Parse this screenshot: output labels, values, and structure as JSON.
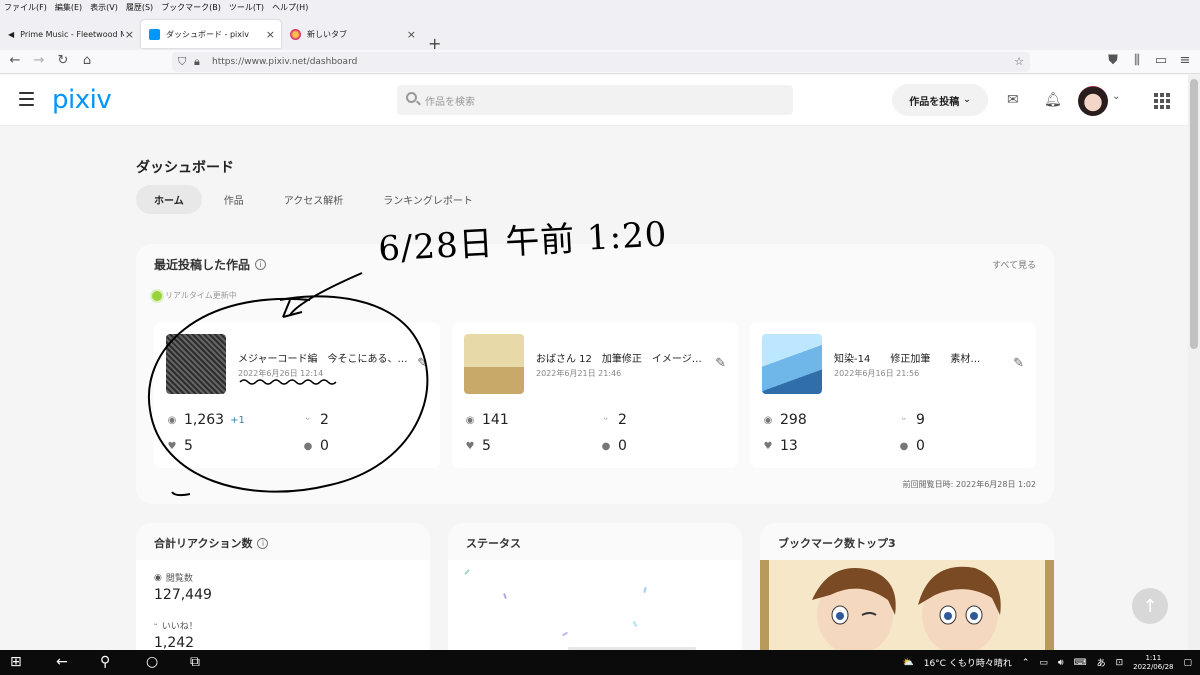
{
  "browser": {
    "menu": [
      "ファイル(F)",
      "編集(E)",
      "表示(V)",
      "履歴(S)",
      "ブックマーク(B)",
      "ツール(T)",
      "ヘルプ(H)"
    ],
    "tabs": [
      {
        "label": "Prime Music - Fleetwood Mac"
      },
      {
        "label": "ダッシュボード - pixiv"
      },
      {
        "label": "新しいタブ"
      }
    ],
    "url": "https://www.pixiv.net/dashboard"
  },
  "header": {
    "logo": "pixiv",
    "search_placeholder": "作品を検索",
    "post_button": "作品を投稿"
  },
  "dashboard": {
    "title": "ダッシュボード",
    "tabs": [
      "ホーム",
      "作品",
      "アクセス解析",
      "ランキングレポート"
    ]
  },
  "recent": {
    "title": "最近投稿した作品",
    "see_all": "すべて見る",
    "realtime": "リアルタイム更新中",
    "works": [
      {
        "title": "メジャーコード編　今そこにある、ち…",
        "date": "2022年6月26日 12:14",
        "views": "1,263",
        "views_delta": "+1",
        "comments_bubble": "2",
        "likes": "5",
        "comments": "0"
      },
      {
        "title": "おばさん 12　加筆修正　イメージ…",
        "date": "2022年6月21日 21:46",
        "views": "141",
        "views_delta": "",
        "comments_bubble": "2",
        "likes": "5",
        "comments": "0"
      },
      {
        "title": "知染-14　　修正加筆　　素材…",
        "date": "2022年6月16日 21:56",
        "views": "298",
        "views_delta": "",
        "comments_bubble": "9",
        "likes": "13",
        "comments": "0"
      }
    ],
    "last_viewed": "前回閲覧日時: 2022年6月28日 1:02"
  },
  "panels": {
    "reactions": {
      "title": "合計リアクション数",
      "views_label": "閲覧数",
      "views": "127,449",
      "likes_label": "いいね！",
      "likes": "1,242"
    },
    "status": {
      "title": "ステータス"
    },
    "bookmarks": {
      "title": "ブックマーク数トップ3"
    }
  },
  "annotation": {
    "text": "6/28日 午前 1:20"
  },
  "taskbar": {
    "weather": "16°C くもり時々晴れ",
    "ime": "あ",
    "time": "1:11",
    "date": "2022/06/28"
  },
  "colors": {
    "brand": "#0096fa",
    "realtime": "#99d33c",
    "delta": "#3d7ea6"
  }
}
